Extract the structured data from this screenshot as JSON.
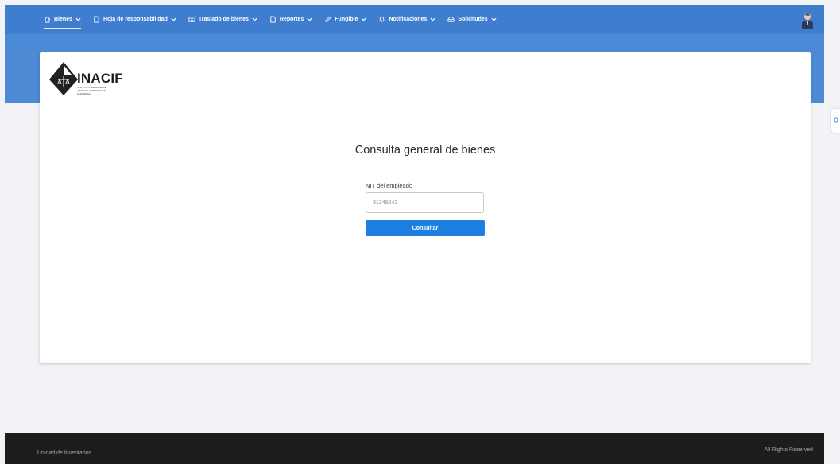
{
  "nav": {
    "items": [
      {
        "label": "Bienes",
        "icon": "home-icon",
        "active": true
      },
      {
        "label": "Hoja de responsabilidad",
        "icon": "document-icon",
        "active": false
      },
      {
        "label": "Traslado de bienes",
        "icon": "transfer-icon",
        "active": false
      },
      {
        "label": "Reportes",
        "icon": "document-icon",
        "active": false
      },
      {
        "label": "Fungible",
        "icon": "pencil-icon",
        "active": false
      },
      {
        "label": "Notificaciones",
        "icon": "bell-icon",
        "active": false
      },
      {
        "label": "Solicitudes",
        "icon": "inbox-icon",
        "active": false
      }
    ]
  },
  "logo": {
    "name": "INACIF",
    "subtitle": "INSTITUTO NACIONAL DE CIENCIAS FORENSES DE GUATEMALA"
  },
  "main": {
    "title": "Consulta general de bienes",
    "field_label": "NIT del empleado",
    "field_value": "31349242",
    "submit_label": "Consultar"
  },
  "footer": {
    "left": "Unidad de Inventarios",
    "right": "All Rights Reserved"
  },
  "colors": {
    "primary": "#3f7ece",
    "button": "#1d7fe0",
    "footer": "#1d1d1d"
  }
}
